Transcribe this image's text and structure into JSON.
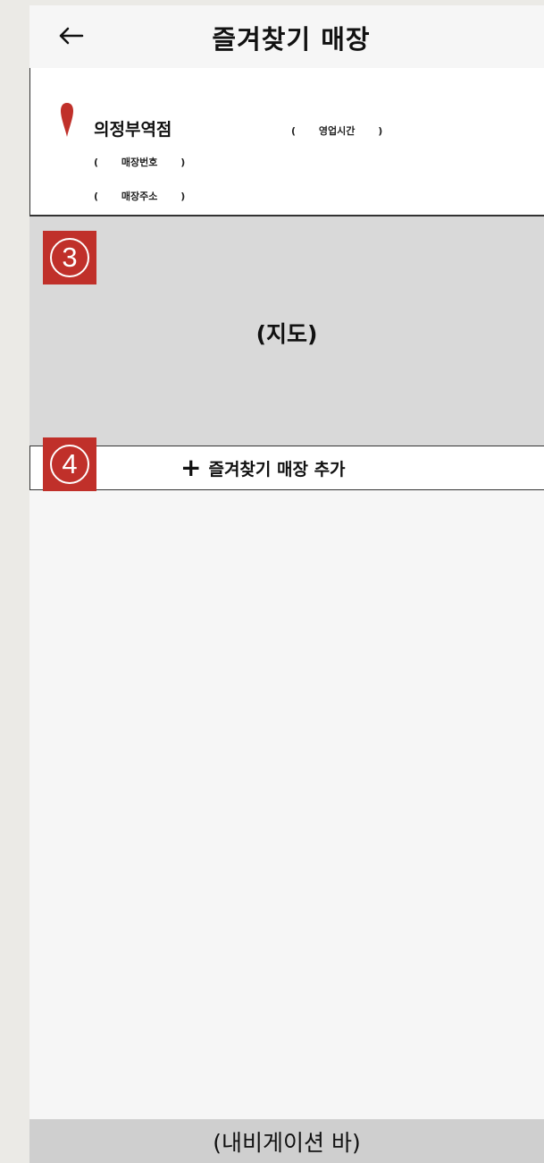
{
  "header": {
    "back_icon": "arrow-left-icon",
    "title": "즐겨찾기 매장"
  },
  "store": {
    "pin_icon": "location-pin-icon",
    "pin_color": "#c0302a",
    "name": "의정부역점",
    "hours_open": "(",
    "hours_label": "영업시간",
    "hours_close": ")",
    "phone_open": "(",
    "phone_label": "매장번호",
    "phone_close": ")",
    "address_open": "(",
    "address_label": "매장주소",
    "address_close": ")"
  },
  "map": {
    "label": "(지도)",
    "badge": "3"
  },
  "add_store": {
    "icon": "plus-icon",
    "label": "즐겨찾기 매장 추가",
    "badge": "4"
  },
  "navbar": {
    "label": "(내비게이션 바)"
  },
  "colors": {
    "badge_red": "#c0302a",
    "map_gray": "#d9d9d9",
    "navbar_gray": "#cfcfcf"
  }
}
